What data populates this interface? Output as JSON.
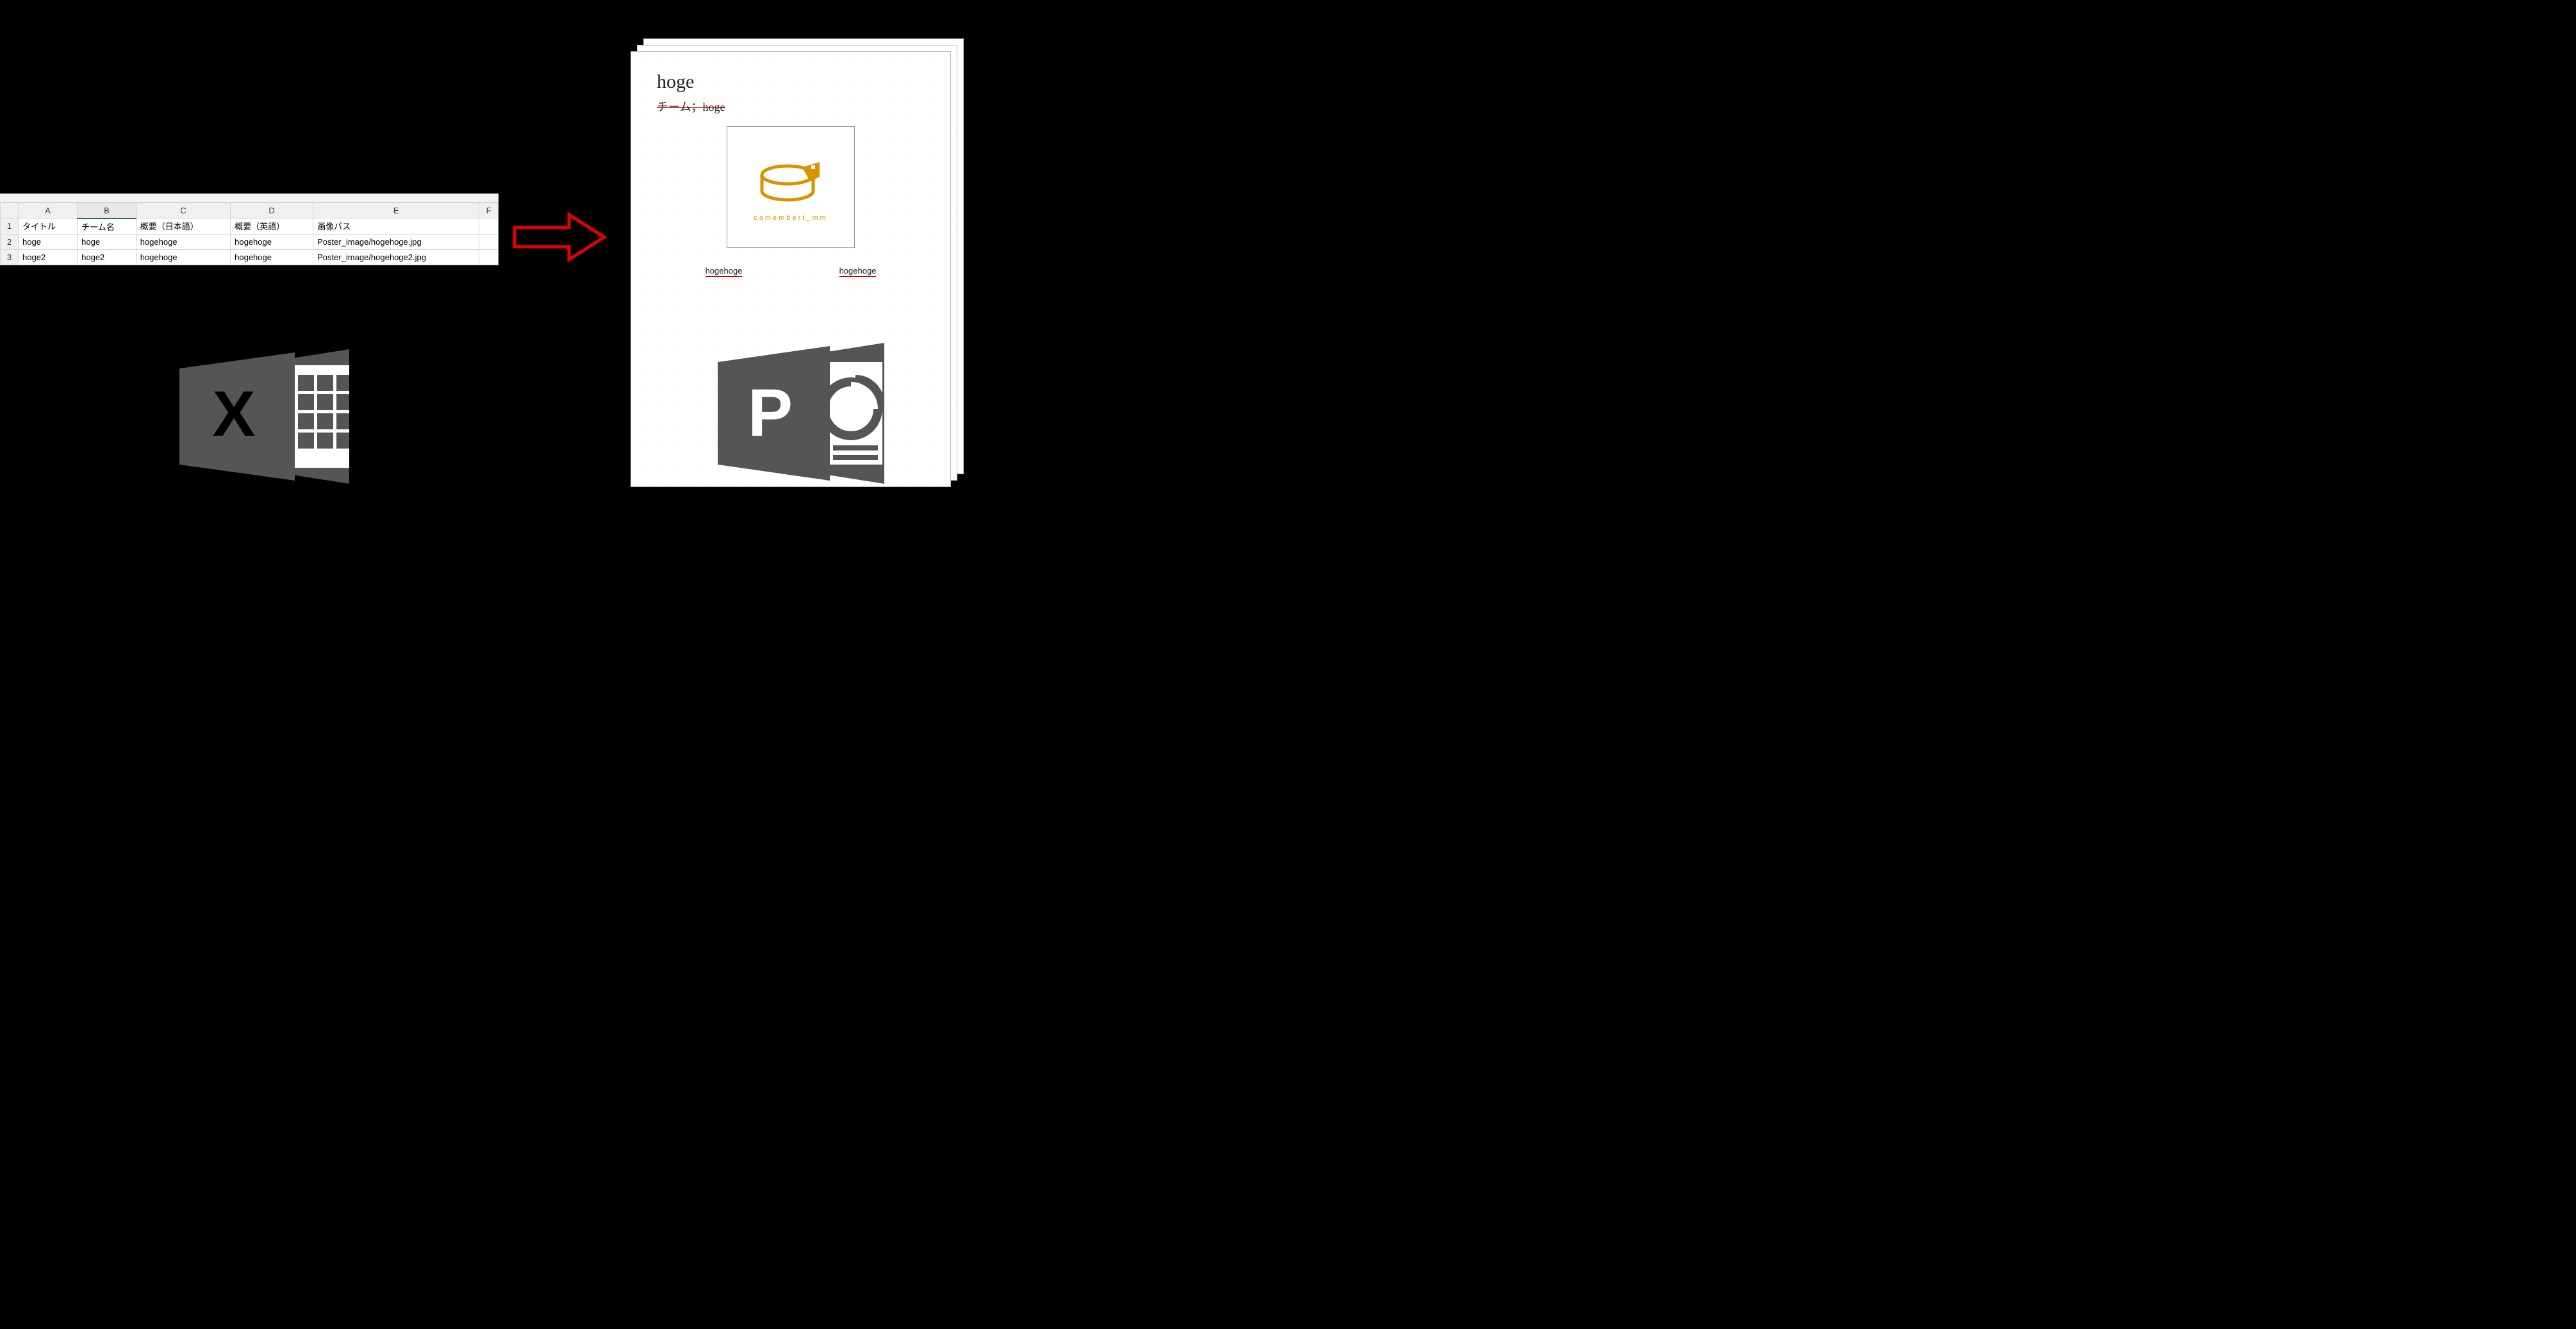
{
  "excel": {
    "columns": [
      "A",
      "B",
      "C",
      "D",
      "E",
      "F"
    ],
    "selected_column_index": 1,
    "headers": {
      "r1c1": "タイトル",
      "r1c2": "チーム名",
      "r1c3": "概要（日本語）",
      "r1c4": "概要（英語）",
      "r1c5": "画像パス",
      "r1c6": ""
    },
    "rows": {
      "r2c1": "hoge",
      "r2c2": "hoge",
      "r2c3": "hogehoge",
      "r2c4": "hogehoge",
      "r2c5": "Poster_image/hogehoge.jpg",
      "r2c6": "",
      "r3c1": "hoge2",
      "r3c2": "hoge2",
      "r3c3": "hogehoge",
      "r3c4": "hogehoge",
      "r3c5": "Poster_image/hogehoge2.jpg",
      "r3c6": ""
    },
    "row_numbers": {
      "r1": "1",
      "r2": "2",
      "r3": "3"
    }
  },
  "slide": {
    "title": "hoge",
    "team": "チーム；hoge",
    "image_label": "camembert_mm",
    "text_jp": "hogehoge",
    "text_en": "hogehoge"
  },
  "icons": {
    "excel_letter": "X",
    "ppt_letter": "P"
  },
  "colors": {
    "arrow": "#e30000",
    "cheese": "#d99200"
  }
}
